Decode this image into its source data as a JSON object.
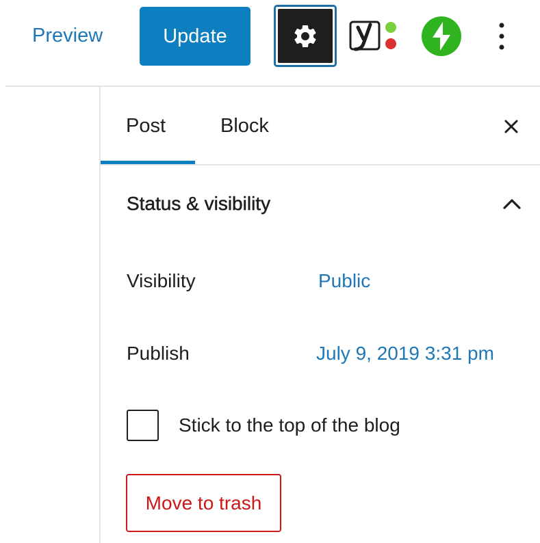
{
  "colors": {
    "accent": "#0d7fc0",
    "link": "#1e78b8",
    "danger": "#cc1818",
    "text": "#1e1e1e",
    "divider": "#e2e4e7",
    "jetpack": "#2fb41f"
  },
  "toolbar": {
    "preview_label": "Preview",
    "update_label": "Update",
    "settings_icon": "gear-icon",
    "yoast_icon": "yoast-seo-icon",
    "jetpack_icon": "jetpack-bolt-icon",
    "more_icon": "vertical-ellipsis-icon"
  },
  "sidebar": {
    "tabs": [
      {
        "label": "Post",
        "active": true
      },
      {
        "label": "Block",
        "active": false
      }
    ],
    "close_icon": "close-icon",
    "panel": {
      "title": "Status & visibility",
      "expanded": true,
      "toggle_icon": "chevron-up-icon",
      "visibility": {
        "label": "Visibility",
        "value": "Public"
      },
      "publish": {
        "label": "Publish",
        "value": "July 9, 2019 3:31 pm"
      },
      "sticky": {
        "label": "Stick to the top of the blog",
        "checked": false
      },
      "trash_label": "Move to trash"
    }
  }
}
